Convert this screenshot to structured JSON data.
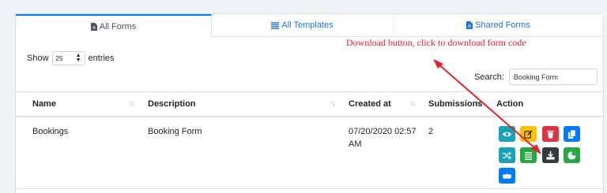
{
  "tabs": [
    {
      "label": "All Forms",
      "icon": "file-icon"
    },
    {
      "label": "All Templates",
      "icon": "list-icon"
    },
    {
      "label": "Shared Forms",
      "icon": "file-icon"
    }
  ],
  "show": {
    "prefix": "Show",
    "value": "25",
    "suffix": "entries"
  },
  "annotation": "Download button, click to download form code",
  "search": {
    "label": "Search:",
    "value": "Booking Form"
  },
  "table": {
    "headers": [
      "Name",
      "Description",
      "Created at",
      "Submissions",
      "Action"
    ],
    "rows": [
      {
        "name": "Bookings",
        "description": "Booking Form",
        "created": "07/20/2020 02:57 AM",
        "submissions": "2"
      }
    ]
  },
  "colors": {
    "accent": "#007bff",
    "info": "#17a2b8",
    "warning": "#ffc107",
    "danger": "#dc3545",
    "primary": "#007bff",
    "success": "#28a745",
    "dark": "#343a40",
    "annotation": "#e8202a"
  },
  "actions": [
    {
      "icon": "eye-icon",
      "color": "#17a2b8"
    },
    {
      "icon": "edit-icon",
      "color": "#ffc107"
    },
    {
      "icon": "trash-icon",
      "color": "#dc3545"
    },
    {
      "icon": "copy-icon",
      "color": "#007bff"
    },
    {
      "icon": "shuffle-icon",
      "color": "#17a2b8"
    },
    {
      "icon": "list-icon",
      "color": "#28a745"
    },
    {
      "icon": "download-icon",
      "color": "#343a40"
    },
    {
      "icon": "pie-chart-icon",
      "color": "#28a745"
    },
    {
      "icon": "handshake-icon",
      "color": "#007bff"
    }
  ]
}
